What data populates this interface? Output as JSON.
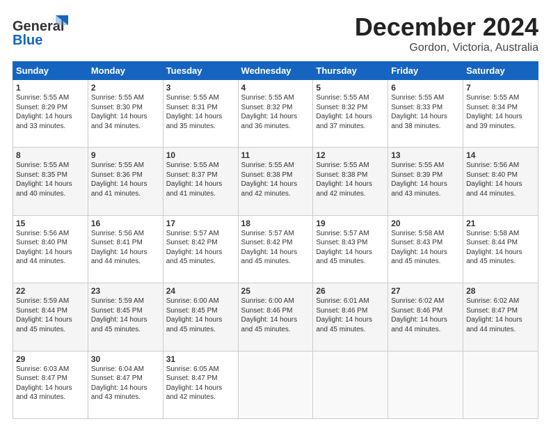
{
  "header": {
    "logo_line1": "General",
    "logo_line2": "Blue",
    "month": "December 2024",
    "location": "Gordon, Victoria, Australia"
  },
  "days_of_week": [
    "Sunday",
    "Monday",
    "Tuesday",
    "Wednesday",
    "Thursday",
    "Friday",
    "Saturday"
  ],
  "weeks": [
    [
      {
        "day": "1",
        "info": "Sunrise: 5:55 AM\nSunset: 8:29 PM\nDaylight: 14 hours\nand 33 minutes."
      },
      {
        "day": "2",
        "info": "Sunrise: 5:55 AM\nSunset: 8:30 PM\nDaylight: 14 hours\nand 34 minutes."
      },
      {
        "day": "3",
        "info": "Sunrise: 5:55 AM\nSunset: 8:31 PM\nDaylight: 14 hours\nand 35 minutes."
      },
      {
        "day": "4",
        "info": "Sunrise: 5:55 AM\nSunset: 8:32 PM\nDaylight: 14 hours\nand 36 minutes."
      },
      {
        "day": "5",
        "info": "Sunrise: 5:55 AM\nSunset: 8:32 PM\nDaylight: 14 hours\nand 37 minutes."
      },
      {
        "day": "6",
        "info": "Sunrise: 5:55 AM\nSunset: 8:33 PM\nDaylight: 14 hours\nand 38 minutes."
      },
      {
        "day": "7",
        "info": "Sunrise: 5:55 AM\nSunset: 8:34 PM\nDaylight: 14 hours\nand 39 minutes."
      }
    ],
    [
      {
        "day": "8",
        "info": "Sunrise: 5:55 AM\nSunset: 8:35 PM\nDaylight: 14 hours\nand 40 minutes."
      },
      {
        "day": "9",
        "info": "Sunrise: 5:55 AM\nSunset: 8:36 PM\nDaylight: 14 hours\nand 41 minutes."
      },
      {
        "day": "10",
        "info": "Sunrise: 5:55 AM\nSunset: 8:37 PM\nDaylight: 14 hours\nand 41 minutes."
      },
      {
        "day": "11",
        "info": "Sunrise: 5:55 AM\nSunset: 8:38 PM\nDaylight: 14 hours\nand 42 minutes."
      },
      {
        "day": "12",
        "info": "Sunrise: 5:55 AM\nSunset: 8:38 PM\nDaylight: 14 hours\nand 42 minutes."
      },
      {
        "day": "13",
        "info": "Sunrise: 5:55 AM\nSunset: 8:39 PM\nDaylight: 14 hours\nand 43 minutes."
      },
      {
        "day": "14",
        "info": "Sunrise: 5:56 AM\nSunset: 8:40 PM\nDaylight: 14 hours\nand 44 minutes."
      }
    ],
    [
      {
        "day": "15",
        "info": "Sunrise: 5:56 AM\nSunset: 8:40 PM\nDaylight: 14 hours\nand 44 minutes."
      },
      {
        "day": "16",
        "info": "Sunrise: 5:56 AM\nSunset: 8:41 PM\nDaylight: 14 hours\nand 44 minutes."
      },
      {
        "day": "17",
        "info": "Sunrise: 5:57 AM\nSunset: 8:42 PM\nDaylight: 14 hours\nand 45 minutes."
      },
      {
        "day": "18",
        "info": "Sunrise: 5:57 AM\nSunset: 8:42 PM\nDaylight: 14 hours\nand 45 minutes."
      },
      {
        "day": "19",
        "info": "Sunrise: 5:57 AM\nSunset: 8:43 PM\nDaylight: 14 hours\nand 45 minutes."
      },
      {
        "day": "20",
        "info": "Sunrise: 5:58 AM\nSunset: 8:43 PM\nDaylight: 14 hours\nand 45 minutes."
      },
      {
        "day": "21",
        "info": "Sunrise: 5:58 AM\nSunset: 8:44 PM\nDaylight: 14 hours\nand 45 minutes."
      }
    ],
    [
      {
        "day": "22",
        "info": "Sunrise: 5:59 AM\nSunset: 8:44 PM\nDaylight: 14 hours\nand 45 minutes."
      },
      {
        "day": "23",
        "info": "Sunrise: 5:59 AM\nSunset: 8:45 PM\nDaylight: 14 hours\nand 45 minutes."
      },
      {
        "day": "24",
        "info": "Sunrise: 6:00 AM\nSunset: 8:45 PM\nDaylight: 14 hours\nand 45 minutes."
      },
      {
        "day": "25",
        "info": "Sunrise: 6:00 AM\nSunset: 8:46 PM\nDaylight: 14 hours\nand 45 minutes."
      },
      {
        "day": "26",
        "info": "Sunrise: 6:01 AM\nSunset: 8:46 PM\nDaylight: 14 hours\nand 45 minutes."
      },
      {
        "day": "27",
        "info": "Sunrise: 6:02 AM\nSunset: 8:46 PM\nDaylight: 14 hours\nand 44 minutes."
      },
      {
        "day": "28",
        "info": "Sunrise: 6:02 AM\nSunset: 8:47 PM\nDaylight: 14 hours\nand 44 minutes."
      }
    ],
    [
      {
        "day": "29",
        "info": "Sunrise: 6:03 AM\nSunset: 8:47 PM\nDaylight: 14 hours\nand 43 minutes."
      },
      {
        "day": "30",
        "info": "Sunrise: 6:04 AM\nSunset: 8:47 PM\nDaylight: 14 hours\nand 43 minutes."
      },
      {
        "day": "31",
        "info": "Sunrise: 6:05 AM\nSunset: 8:47 PM\nDaylight: 14 hours\nand 42 minutes."
      },
      {
        "day": "",
        "info": ""
      },
      {
        "day": "",
        "info": ""
      },
      {
        "day": "",
        "info": ""
      },
      {
        "day": "",
        "info": ""
      }
    ]
  ]
}
